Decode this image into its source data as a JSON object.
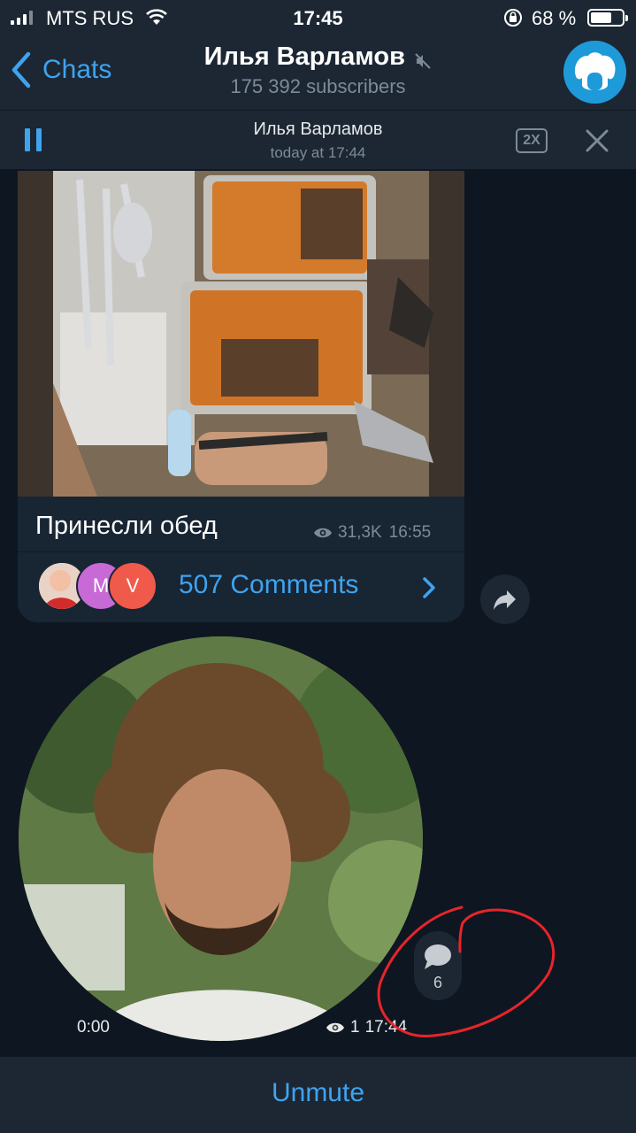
{
  "status_bar": {
    "carrier": "MTS RUS",
    "time": "17:45",
    "battery": "68 %",
    "battery_level": 0.68
  },
  "header": {
    "back_label": "Chats",
    "title": "Илья Варламов",
    "subtitle": "175 392 subscribers",
    "accent_color": "#3fa3ef"
  },
  "player": {
    "title": "Илья Варламов",
    "time": "today at 17:44",
    "speed": "2X"
  },
  "post": {
    "caption": "Принесли обед",
    "views": "31,3K",
    "time": "16:55",
    "comments_label": "507 Comments",
    "commenters": [
      "",
      "M",
      "V"
    ]
  },
  "video_message": {
    "duration": "0:00",
    "views": "1",
    "time": "17:44",
    "comment_count": "6"
  },
  "footer": {
    "unmute_label": "Unmute"
  }
}
